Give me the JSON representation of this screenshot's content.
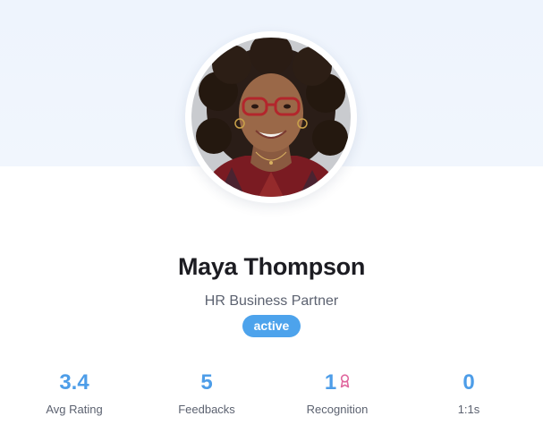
{
  "profile": {
    "name": "Maya Thompson",
    "role": "HR Business Partner",
    "status": "active",
    "avatar": "portrait-photo"
  },
  "stats": [
    {
      "value": "3.4",
      "label": "Avg Rating"
    },
    {
      "value": "5",
      "label": "Feedbacks"
    },
    {
      "value": "1",
      "label": "Recognition",
      "icon": "award-ribbon-icon"
    },
    {
      "value": "0",
      "label": "1:1s"
    }
  ],
  "colors": {
    "accent": "#4d9de8",
    "badge": "#4da3ec",
    "award_icon": "#e0679e",
    "banner": "#eef4fd"
  }
}
